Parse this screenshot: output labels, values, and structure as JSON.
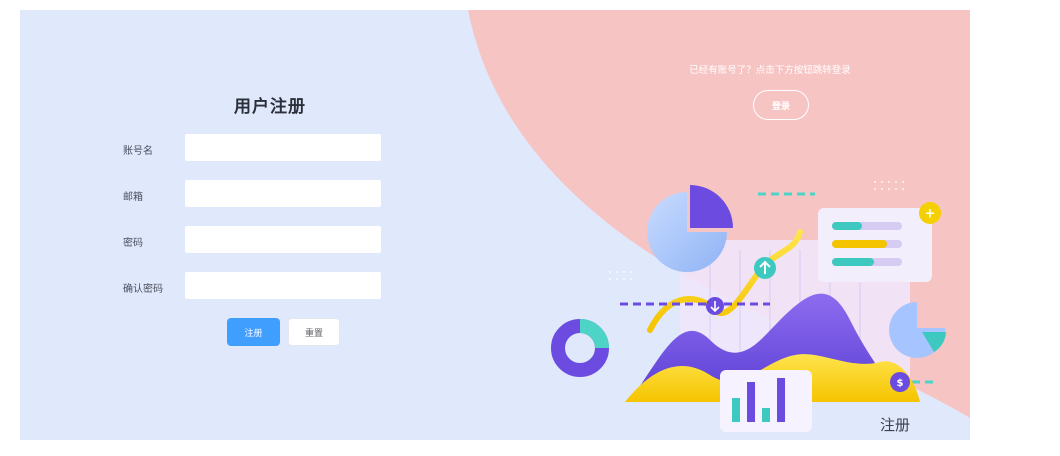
{
  "form": {
    "title": "用户注册",
    "fields": [
      {
        "label": "账号名",
        "value": "",
        "placeholder": ""
      },
      {
        "label": "邮箱",
        "value": "",
        "placeholder": ""
      },
      {
        "label": "密码",
        "value": "",
        "placeholder": ""
      },
      {
        "label": "确认密码",
        "value": "",
        "placeholder": ""
      }
    ],
    "register_label": "注册",
    "reset_label": "重置"
  },
  "side": {
    "prompt": "已经有账号了？点击下方按钮跳转登录",
    "login_label": "登录",
    "caption": "注册"
  },
  "illustration": {
    "coin_symbol": "$",
    "plus_symbol": "+"
  },
  "colors": {
    "left_bg": "#e0e8fc",
    "right_bg": "#f7c4c4",
    "primary": "#409eff"
  }
}
